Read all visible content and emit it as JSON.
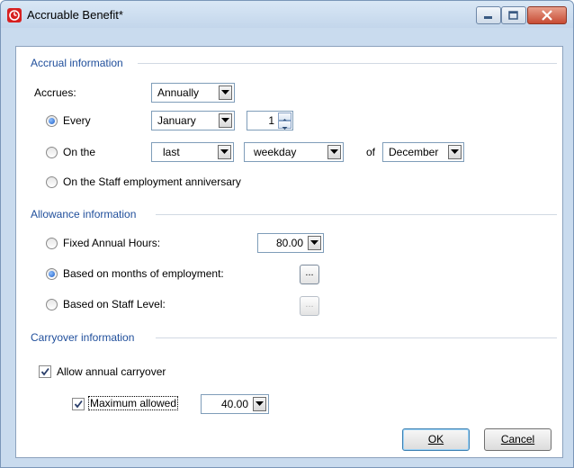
{
  "window": {
    "title": "Accruable Benefit*"
  },
  "accrual": {
    "section_title": "Accrual information",
    "accrues_label": "Accrues:",
    "accrues_value": "Annually",
    "every_label": "Every",
    "every_month": "January",
    "every_day": "1",
    "on_the_label": "On the",
    "on_the_position": "last",
    "on_the_day_type": "weekday",
    "of_label": "of",
    "on_the_month": "December",
    "anniversary_label": "On the Staff employment anniversary",
    "selected": "every"
  },
  "allowance": {
    "section_title": "Allowance information",
    "fixed_label": "Fixed Annual Hours:",
    "fixed_value": "80.00",
    "months_label": "Based on months of employment:",
    "months_button": "...",
    "level_label": "Based on Staff Level:",
    "level_button": "...",
    "selected": "months"
  },
  "carryover": {
    "section_title": "Carryover information",
    "allow_label": "Allow annual carryover",
    "allow_checked": true,
    "max_label": "Maximum allowed",
    "max_checked": true,
    "max_value": "40.00"
  },
  "buttons": {
    "ok": "OK",
    "cancel": "Cancel"
  }
}
